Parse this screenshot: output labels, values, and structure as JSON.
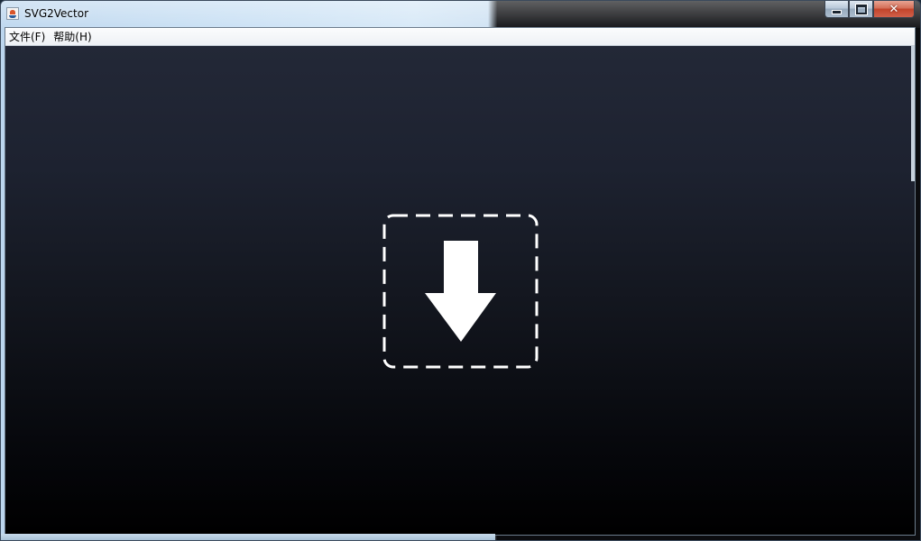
{
  "window": {
    "title": "SVG2Vector",
    "app_icon": "java-coffee-cup-icon"
  },
  "caption_buttons": {
    "minimize_icon": "minimize-icon",
    "maximize_icon": "maximize-icon",
    "close_glyph": "✕"
  },
  "menubar": {
    "items": [
      {
        "label": "文件(F)"
      },
      {
        "label": "帮助(H)"
      }
    ]
  },
  "main": {
    "drop_icon": "download-arrow-icon",
    "colors": {
      "drop_icon": "#ffffff",
      "canvas_top": "#232837",
      "canvas_bottom": "#000000"
    }
  }
}
